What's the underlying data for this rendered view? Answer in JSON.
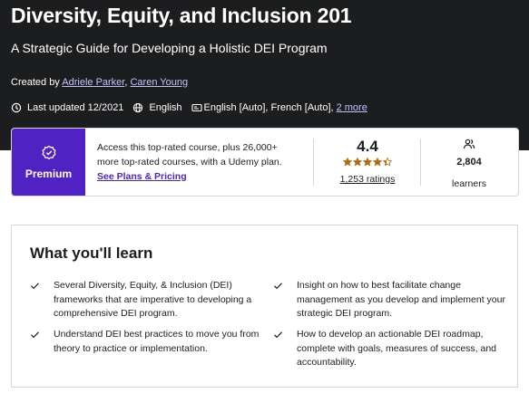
{
  "hero": {
    "title": "Diversity, Equity, and Inclusion 201",
    "subtitle": "A Strategic Guide for Developing a Holistic DEI Program",
    "created_by_label": "Created by",
    "instructors": [
      "Adriele Parker",
      "Caren Young"
    ],
    "last_updated": "Last updated 12/2021",
    "language": "English",
    "captions": "English [Auto], French [Auto],",
    "captions_more": "2 more",
    "icons": {
      "updated": "alert-clock-icon",
      "language": "globe-icon",
      "captions": "closed-captions-icon"
    }
  },
  "premium_card": {
    "badge_label": "Premium",
    "badge_icon": "premium-badge-icon",
    "promo_text": "Access this top-rated course, plus 26,000+ more top-rated courses, with a Udemy plan.",
    "promo_link": "See Plans & Pricing",
    "rating_value": "4.4",
    "rating_stars": 4.4,
    "ratings_count": "1,253 ratings",
    "learners_count": "2,804",
    "learners_label": "learners",
    "learners_icon": "people-icon"
  },
  "learn": {
    "heading": "What you'll learn",
    "items": [
      "Several Diversity, Equity, & Inclusion (DEI) frameworks that are imperative to developing a comprehensive DEI program.",
      "Insight on how to best facilitate change management as you develop and implement your strategic DEI program.",
      "Understand DEI best practices to move you from theory to practice or implementation.",
      "How to develop an actionable DEI roadmap, complete with goals, measures of success, and accountability."
    ]
  },
  "colors": {
    "hero_bg": "#1c1d1f",
    "premium_purple": "#5022c3",
    "link_light": "#c0c4fc",
    "star": "#b4690e"
  }
}
